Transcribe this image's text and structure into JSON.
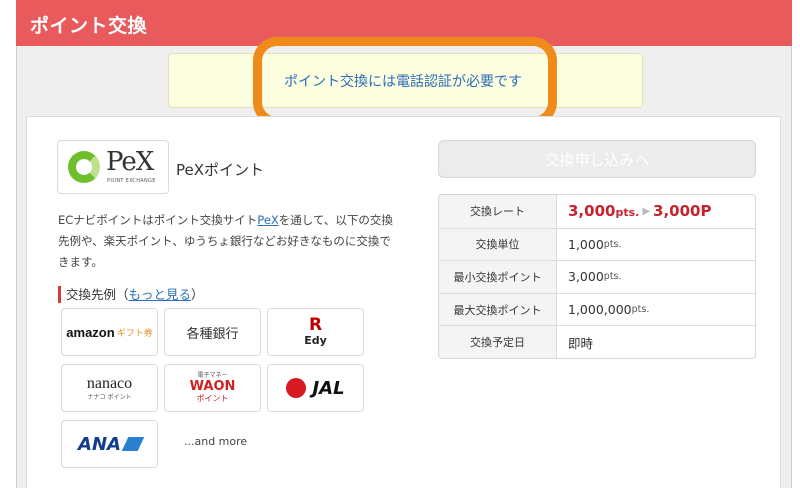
{
  "header": {
    "title": "ポイント交換"
  },
  "notice": {
    "text": "ポイント交換には電話認証が必要です"
  },
  "pex": {
    "logo_word": "PeX",
    "logo_sub": "POINT EXCHANGE",
    "name": "PeXポイント",
    "desc_before": "ECナビポイントはポイント交換サイト",
    "desc_link": "PeX",
    "desc_after": "を通して、以下の交換先例や、楽天ポイント、ゆうちょ銀行などお好きなものに交換できます。"
  },
  "examples": {
    "heading_prefix": "交換先例（",
    "more_link": "もっと見る",
    "heading_suffix": "）",
    "tiles": [
      {
        "id": "amazon",
        "text_a": "amazon",
        "text_b": "ギフト券"
      },
      {
        "id": "bank",
        "text": "各種銀行"
      },
      {
        "id": "edy",
        "text_r": "R",
        "text": "Edy"
      },
      {
        "id": "nanaco",
        "text": "nanaco",
        "sub": "ナナコ ポイント"
      },
      {
        "id": "waon",
        "text_top": "電子マネー",
        "text": "WAON",
        "sub": "ポイント"
      },
      {
        "id": "jal",
        "text": "JAL"
      },
      {
        "id": "ana",
        "text": "ANA"
      }
    ],
    "and_more": "...and more"
  },
  "apply_button": "交換申し込みへ",
  "table": {
    "rows": [
      {
        "label": "交換レート",
        "from_value": "3,000",
        "from_unit": "pts.",
        "to_value": "3,000P"
      },
      {
        "label": "交換単位",
        "value": "1,000",
        "unit": "pts."
      },
      {
        "label": "最小交換ポイント",
        "value": "3,000",
        "unit": "pts."
      },
      {
        "label": "最大交換ポイント",
        "value": "1,000,000",
        "unit": "pts."
      },
      {
        "label": "交換予定日",
        "value": "即時",
        "unit": ""
      }
    ]
  },
  "colors": {
    "header": "#e85a5c",
    "highlight": "#f08a1a",
    "notice_bg": "#fdfde0",
    "link": "#2a6fb8",
    "rate": "#c8232c"
  }
}
